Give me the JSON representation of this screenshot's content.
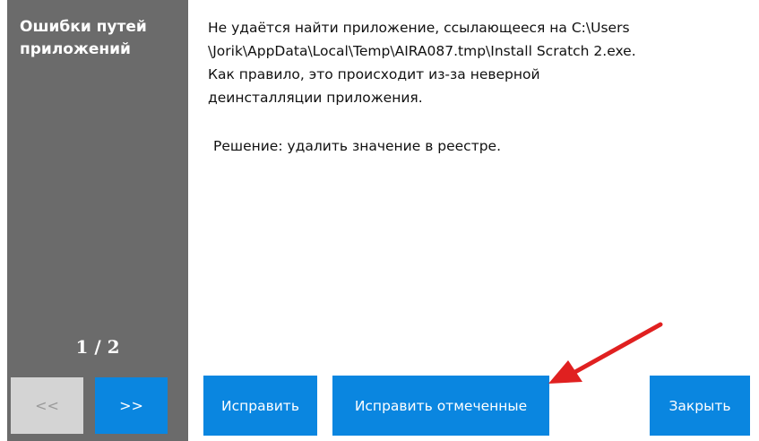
{
  "sidebar": {
    "title_line1": "Ошибки путей",
    "title_line2": "приложений",
    "page_counter": "1 / 2",
    "prev_label": "<<",
    "next_label": ">>"
  },
  "message": {
    "lines": [
      "Не удаётся найти приложение, ссылающееся на C:\\Users",
      "\\Jorik\\AppData\\Local\\Temp\\AIRA087.tmp\\Install Scratch 2.exe.",
      "Как правило, это происходит из-за неверной",
      "деинсталляции приложения."
    ],
    "solution": "Решение: удалить значение в реестре."
  },
  "buttons": {
    "fix": "Исправить",
    "fix_marked": "Исправить отмеченные",
    "close": "Закрыть"
  },
  "colors": {
    "sidebar_bg": "#6b6b6b",
    "accent": "#0a86e0",
    "disabled_bg": "#d4d4d4",
    "arrow": "#e02020"
  },
  "annotation": {
    "icon": "red-arrow-icon"
  }
}
